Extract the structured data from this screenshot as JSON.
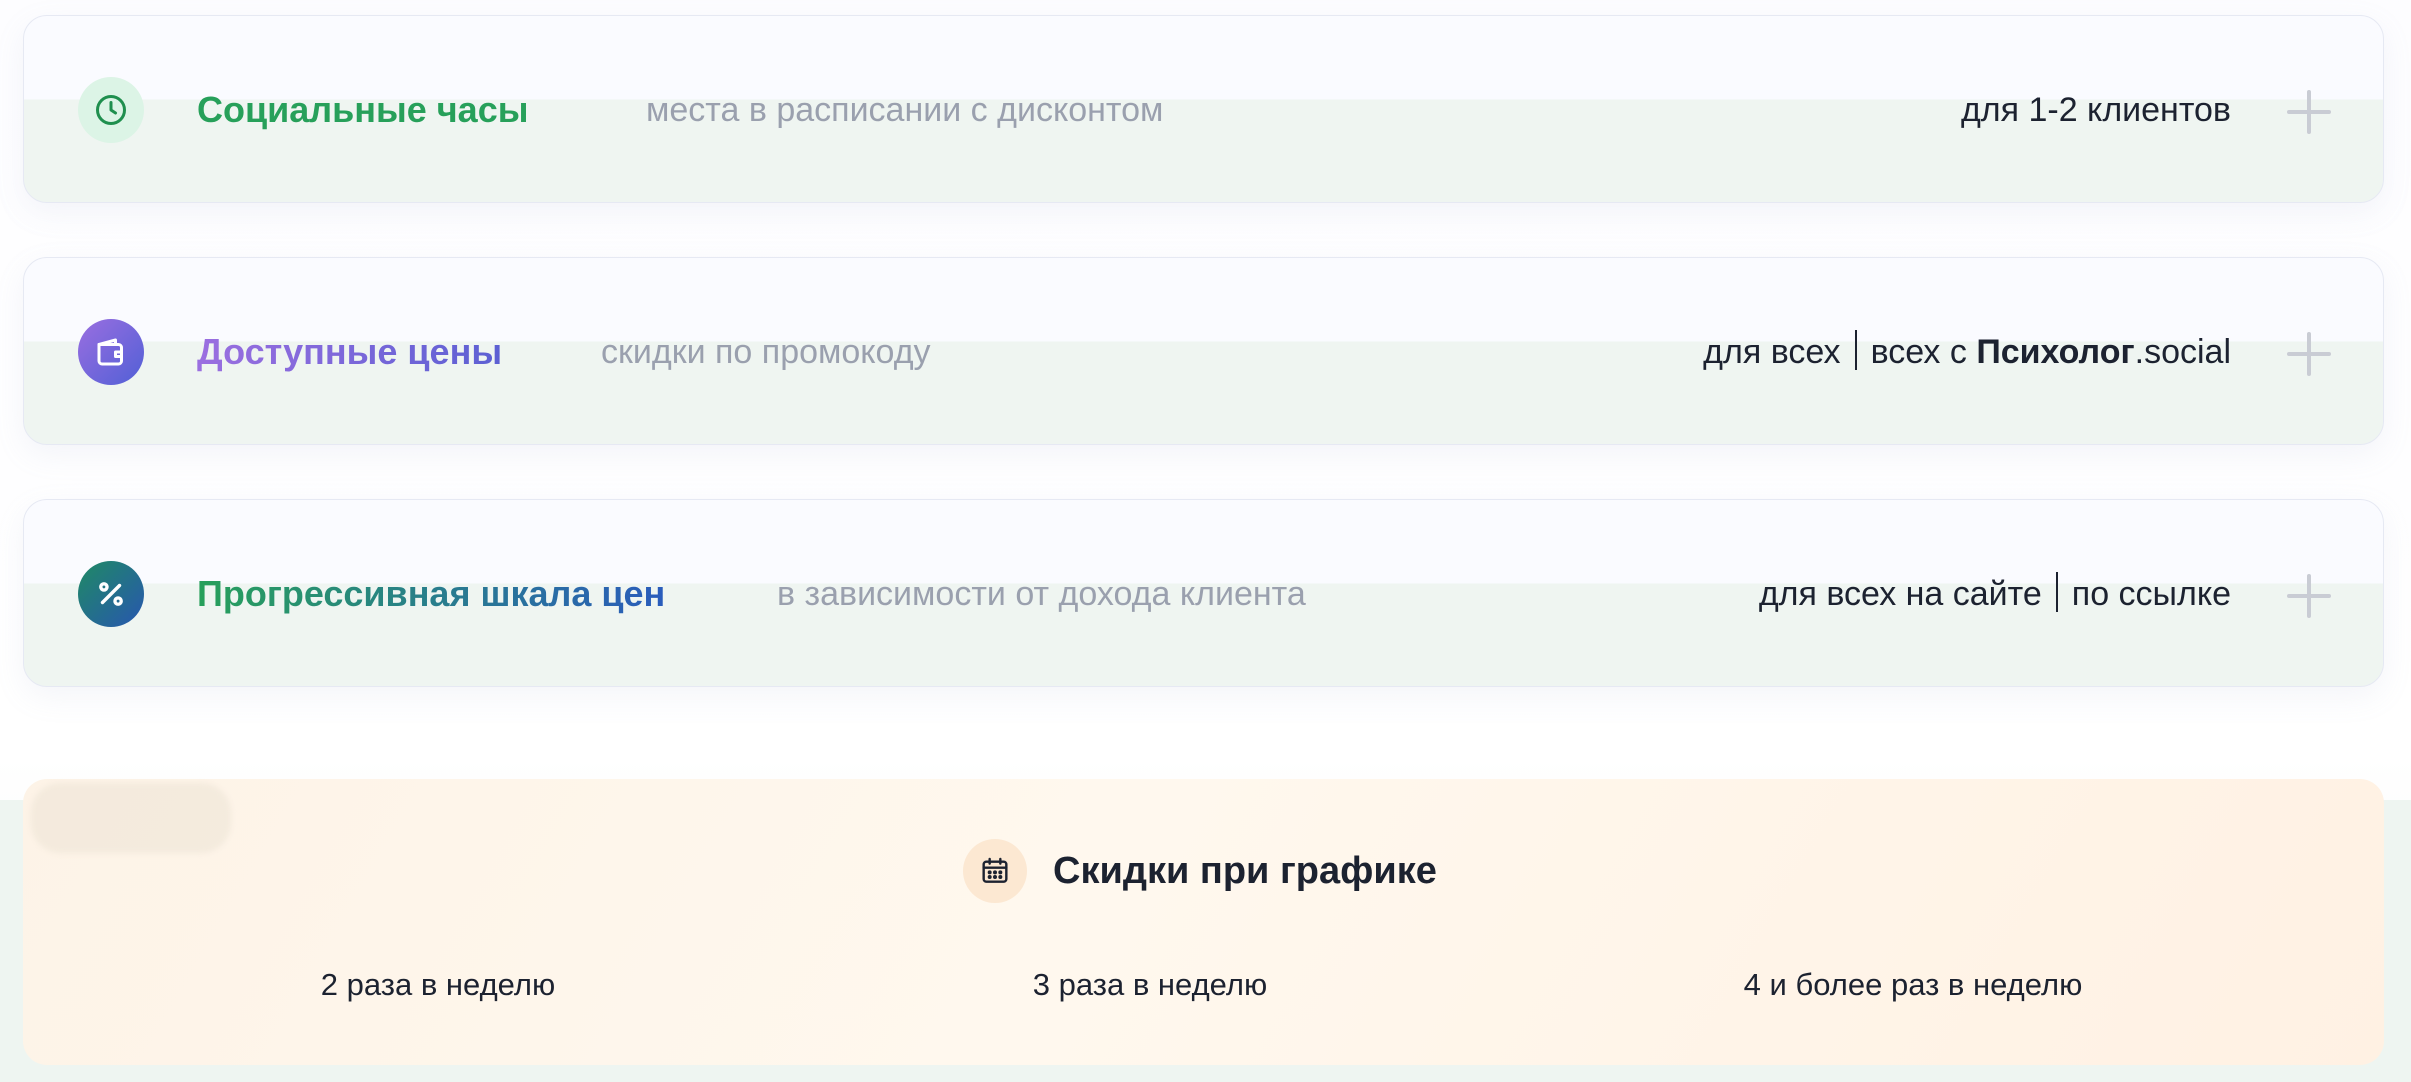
{
  "programs": [
    {
      "title": "Социальные часы",
      "subtitle": "места в расписании с дисконтом",
      "audience": "для 1-2 клиентов",
      "icon": "clock-icon"
    },
    {
      "title": "Доступные цены",
      "subtitle": "скидки по промокоду",
      "audience_part1": "для всех",
      "audience_part2_prefix": "всех с ",
      "audience_brand_bold": "Психолог",
      "audience_brand_rest": ".social",
      "icon": "wallet-icon"
    },
    {
      "title": "Прогрессивная шкала цен",
      "subtitle": "в зависимости от дохода клиента",
      "audience_part1": "для всех на сайте",
      "audience_part2": "по ссылке",
      "icon": "percent-icon"
    }
  ],
  "schedule_discounts": {
    "title": "Скидки при графике",
    "icon": "calendar-icon",
    "options": [
      "2 раза в неделю",
      "3 раза в неделю",
      "4 и более раз в неделю"
    ]
  },
  "colors": {
    "social_title": "#27a05a",
    "affordable_gradient": [
      "#9b6fe0",
      "#5c60d3"
    ],
    "progressive_gradient": [
      "#27a05a",
      "#2a5cbc"
    ],
    "muted_text": "#9aa0ae",
    "dark_text": "#1c2230",
    "schedule_bg": "#fff4e8"
  }
}
